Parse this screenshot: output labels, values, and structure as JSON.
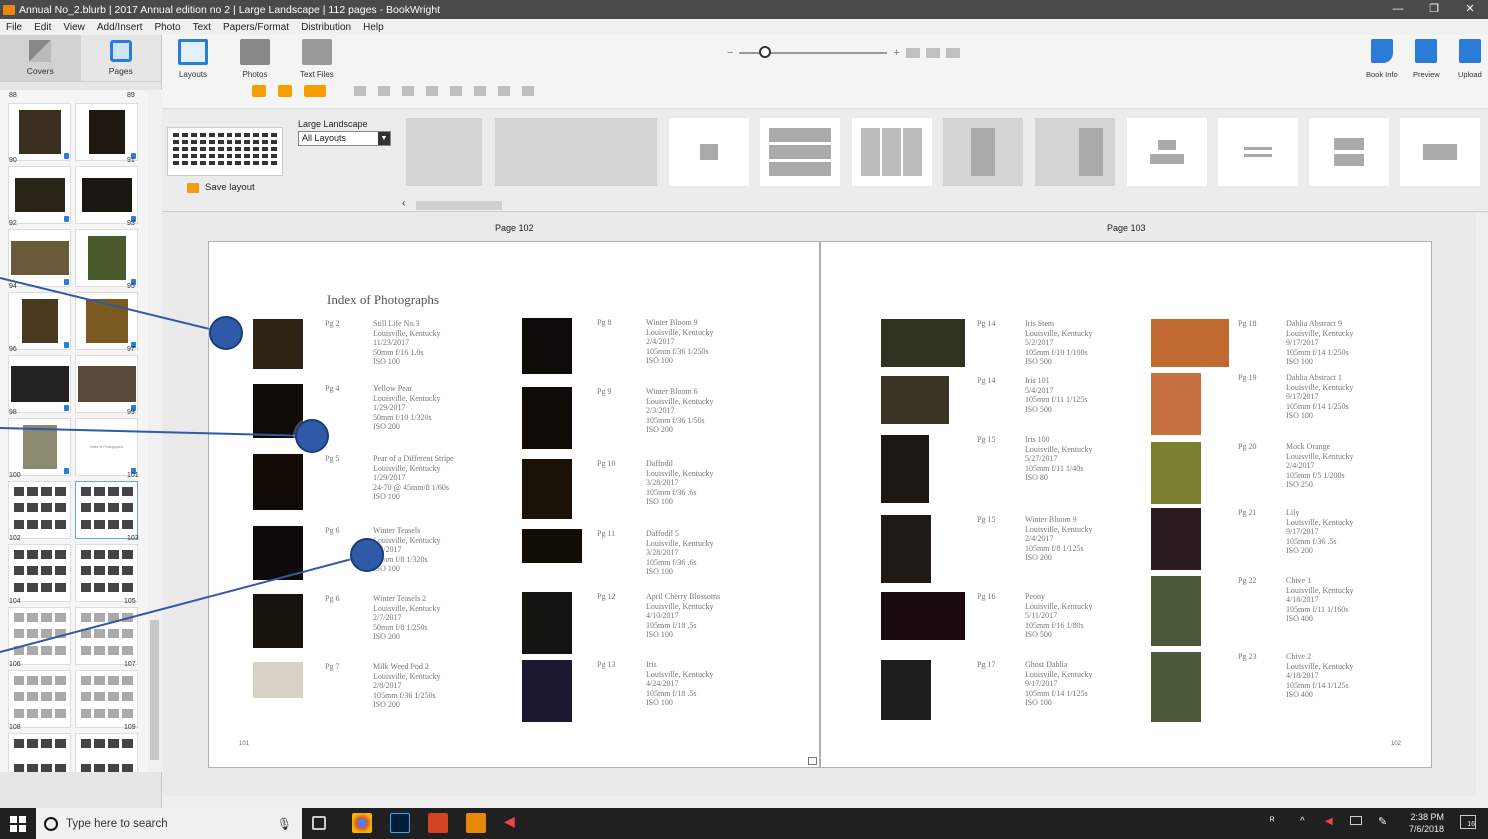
{
  "window": {
    "title": "Annual No_2.blurb | 2017 Annual edition no 2 | Large Landscape | 112 pages - BookWright",
    "controls": [
      "—",
      "❐",
      "✕"
    ]
  },
  "menu": [
    "File",
    "Edit",
    "View",
    "Add/Insert",
    "Photo",
    "Text",
    "Papers/Format",
    "Distribution",
    "Help"
  ],
  "left_tabs": {
    "covers": "Covers",
    "pages": "Pages"
  },
  "page_numbers": {
    "r88": [
      "88",
      "89"
    ],
    "r90": [
      "90",
      "91"
    ],
    "r92": [
      "92",
      "93"
    ],
    "r94": [
      "94",
      "95"
    ],
    "r96": [
      "96",
      "97"
    ],
    "r98": [
      "98",
      "99"
    ],
    "r100": [
      "100",
      "101"
    ],
    "r102": [
      "102",
      "103"
    ],
    "r104": [
      "104",
      "105"
    ],
    "r106": [
      "106",
      "107"
    ],
    "r108": [
      "108",
      "109"
    ]
  },
  "thumb_text_101": "Index of Photographs",
  "toolbar": {
    "layouts": "Layouts",
    "photos": "Photos",
    "text_files": "Text Files"
  },
  "zoom": {
    "minus": "−",
    "plus": "+",
    "level": 0.1
  },
  "right_toolbar": {
    "book_info": "Book Info",
    "preview": "Preview",
    "upload": "Upload"
  },
  "layouts": {
    "label": "Large Landscape",
    "filter_selected": "All Layouts",
    "save_label": "Save layout",
    "scroll_left": "‹",
    "scroll_right": "›"
  },
  "pages": {
    "left_label": "Page 102",
    "right_label": "Page 103",
    "left_title": "Index of Photographs",
    "left_folio": "101",
    "right_folio": "102"
  },
  "left_entries": [
    {
      "pg": "Pg 2",
      "text": "Still Life No.3\nLouisville, Kentucky\n11/23/2017\n50mm f/16 1.0s\nISO 100"
    },
    {
      "pg": "Pg 4",
      "text": "Yellow Pear\nLouisville, Kentucky\n1/29/2017\n50mm f/10 1/320s\nISO 200"
    },
    {
      "pg": "Pg 5",
      "text": "Pear of a Different Stripe\nLouisville, Kentucky\n1/29/2017\n24-70 @ 45mm/8 1/60s\nISO 100"
    },
    {
      "pg": "Pg 6",
      "text": "Winter Teasels\nLouisville, Kentucky\n2/7/2017\n50mm f/8 1/320s\nISO 100"
    },
    {
      "pg": "Pg 6",
      "text": "Winter Teasels 2\nLouisville, Kentucky\n2/7/2017\n50mm f/8 1/250s\nISO 200"
    },
    {
      "pg": "Pg 7",
      "text": "Milk Weed Pod 2\nLouisville, Kentucky\n2/8/2017\n105mm f/36 1/250s\nISO 200"
    },
    {
      "pg": "Pg 8",
      "text": "Winter Bloom 9\nLouisville, Kentucky\n2/4/2017\n105mm f/36 1/250s\nISO 100"
    },
    {
      "pg": "Pg 9",
      "text": "Winter Bloom 6\nLouisville, Kentucky\n2/3/2017\n105mm f/36 1/50s\nISO 200"
    },
    {
      "pg": "Pg 10",
      "text": "Daffodil\nLouisville, Kentucky\n3/28/2017\n105mm f/36 .6s\nISO 100"
    },
    {
      "pg": "Pg 11",
      "text": "Daffodil 5\nLouisville, Kentucky\n3/28/2017\n105mm f/36 .6s\nISO 100"
    },
    {
      "pg": "Pg 12",
      "text": "April Cherry Blossoms\nLouisville, Kentucky\n4/10/2017\n105mm f/18 .5s\nISO 100"
    },
    {
      "pg": "Pg 13",
      "text": "Iris\nLouisville, Kentucky\n4/24/2017\n105mm f/18 .5s\nISO 100"
    }
  ],
  "right_entries": [
    {
      "pg": "Pg 14",
      "text": "Iris Stem\nLouisville, Kentucky\n5/2/2017\n105mm f/10 1/100s\nISO 500"
    },
    {
      "pg": "Pg 14",
      "text": "Iris 101\n5/4/2017\n105mm f/11 1/125s\nISO 500"
    },
    {
      "pg": "Pg 15",
      "text": "Iris 100\nLouisville, Kentucky\n5/27/2017\n105mm f/11 1/40s\nISO 80"
    },
    {
      "pg": "Pg 15",
      "text": "Winter Bloom 9\nLouisville, Kentucky\n2/4/2017\n105mm f/8 1/125s\nISO 200"
    },
    {
      "pg": "Pg 16",
      "text": "Peony\nLouisville, Kentucky\n5/11/2017\n105mm f/16 1/80s\nISO 500"
    },
    {
      "pg": "Pg 17",
      "text": "Ghost Dahlia\nLouisville, Kentucky\n9/17/2017\n105mm f/14 1/125s\nISO 100"
    },
    {
      "pg": "Pg 18",
      "text": "Dahlia Abstract 9\nLouisville, Kentucky\n9/17/2017\n105mm f/14 1/250s\nISO 100"
    },
    {
      "pg": "Pg 19",
      "text": "Dahlia Abstract 1\nLouisville, Kentucky\n9/17/2017\n105mm f/14 1/250s\nISO 100"
    },
    {
      "pg": "Pg 20",
      "text": "Mock Orange\nLouisville, Kentucky\n2/4/2017\n105mm f/5 1/200s\nISO 250"
    },
    {
      "pg": "Pg 21",
      "text": "Lily\nLouisville, Kentucky\n9/17/2017\n105mm f/36 .5s\nISO 200"
    },
    {
      "pg": "Pg 22",
      "text": "Chive 1\nLouisville, Kentucky\n4/18/2017\n105mm f/11 1/160s\nISO 400"
    },
    {
      "pg": "Pg 23",
      "text": "Chive 2\nLouisville, Kentucky\n4/18/2017\n105mm f/14 1/125s\nISO 400"
    }
  ],
  "taskbar": {
    "search_placeholder": "Type here to search",
    "time": "2:38 PM",
    "date": "7/6/2018",
    "notifications": "16"
  },
  "colors": {
    "accent_orange": "#f39c12",
    "accent_blue": "#2b7bd9",
    "annotation": "#2f5aa8"
  }
}
